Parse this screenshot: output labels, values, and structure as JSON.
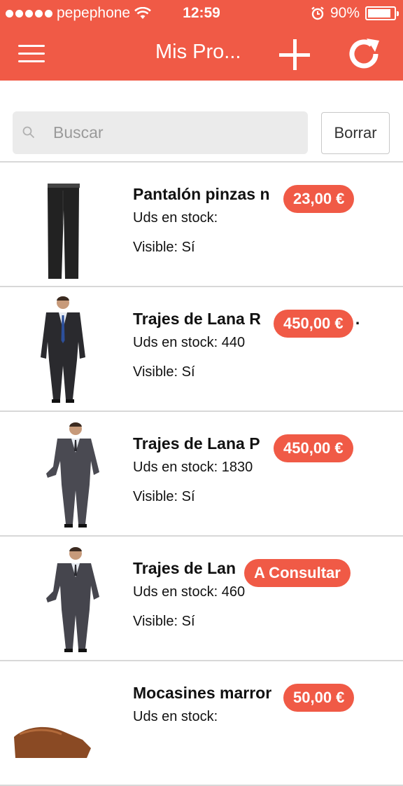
{
  "status_bar": {
    "carrier": "pepephone",
    "time": "12:59",
    "battery": "90%",
    "battery_level": 0.9,
    "icons": [
      "signal-dots-icon",
      "wifi-icon",
      "alarm-icon",
      "battery-icon"
    ]
  },
  "nav": {
    "title": "Mis Pro...",
    "icons": [
      "menu-icon",
      "plus-icon",
      "refresh-icon"
    ],
    "accent_color": "#f05a46"
  },
  "search": {
    "placeholder": "Buscar",
    "value": "",
    "clear_label": "Borrar"
  },
  "products": [
    {
      "name": "Pantalón pinzas n",
      "stock": "Uds en stock:",
      "visible": "Visible: Sí",
      "price": "23,00 €",
      "image": "trousers"
    },
    {
      "name": "Trajes de Lana R",
      "trail": ".",
      "stock": "Uds en stock: 440",
      "visible": "Visible: Sí",
      "price": "450,00 €",
      "image": "suit"
    },
    {
      "name": "Trajes de Lana P",
      "trail": "..",
      "stock": "Uds en stock: 1830",
      "visible": "Visible: Sí",
      "price": "450,00 €",
      "image": "suit"
    },
    {
      "name": "Trajes de Lan",
      "stock": "Uds en stock: 460",
      "visible": "Visible: Sí",
      "price": "A Consultar",
      "image": "suit"
    },
    {
      "name": "Mocasines marror",
      "stock": "Uds en stock:",
      "visible": "",
      "price": "50,00 €",
      "image": "shoe"
    }
  ]
}
